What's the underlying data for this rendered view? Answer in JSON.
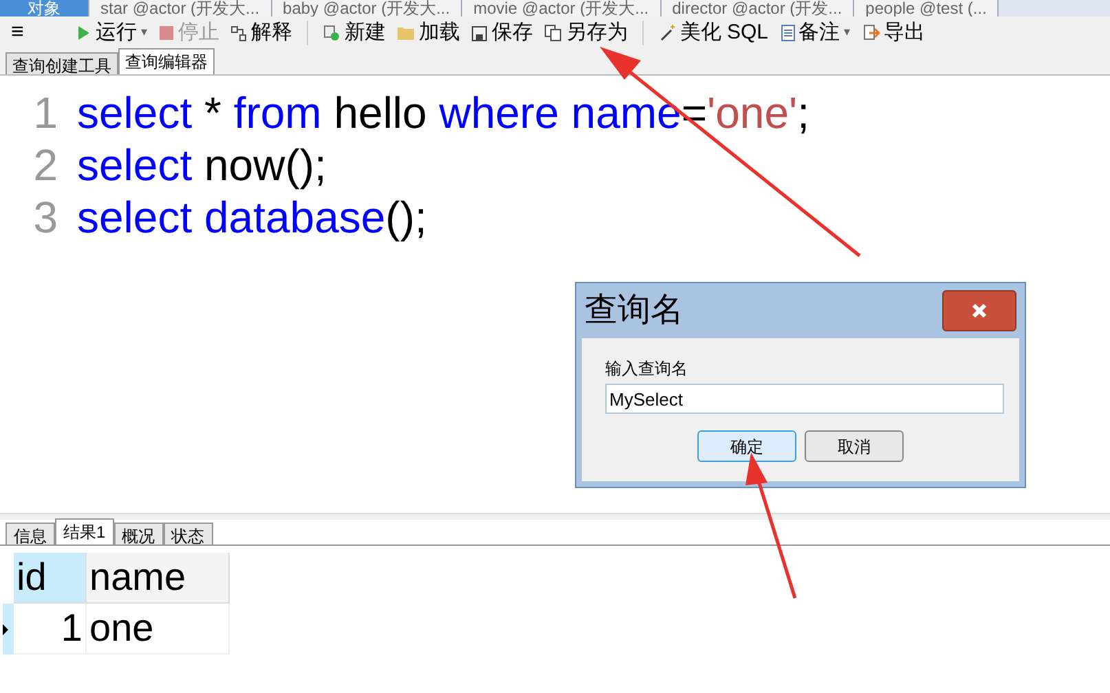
{
  "doc_tabs": [
    {
      "label": "对象",
      "selected": true
    },
    {
      "label": "star @actor (开发大...",
      "selected": false
    },
    {
      "label": "baby @actor (开发大...",
      "selected": false
    },
    {
      "label": "movie @actor (开发大...",
      "selected": false
    },
    {
      "label": "director @actor (开发...",
      "selected": false
    },
    {
      "label": "people @test (...",
      "selected": false
    }
  ],
  "toolbar": [
    {
      "label": "运行",
      "kind": "play",
      "caret": "▾"
    },
    {
      "label": "停止",
      "kind": "stop",
      "disabled": true
    },
    {
      "label": "解释",
      "kind": "explain",
      "disabled": false
    },
    {
      "label": "新建",
      "kind": "new",
      "disabled": false
    },
    {
      "label": "加载",
      "kind": "folder",
      "disabled": false
    },
    {
      "label": "保存",
      "kind": "save",
      "disabled": false
    },
    {
      "label": "另存为",
      "kind": "saveas",
      "disabled": false
    },
    {
      "label": "美化 SQL",
      "kind": "wand",
      "disabled": false
    },
    {
      "label": "备注",
      "kind": "note",
      "caret": "▾"
    },
    {
      "label": "导出",
      "kind": "export",
      "disabled": false
    }
  ],
  "menu_icon": "≡",
  "editor_tabs": [
    {
      "label": "查询创建工具",
      "selected": false
    },
    {
      "label": "查询编辑器",
      "selected": true
    }
  ],
  "code_lines": [
    {
      "number": "1",
      "tokens": [
        {
          "kind": "keyword",
          "text": "select"
        },
        {
          "kind": "plain",
          "text": " * "
        },
        {
          "kind": "keyword",
          "text": "from"
        },
        {
          "kind": "plain",
          "text": " hello "
        },
        {
          "kind": "keyword",
          "text": "where name"
        },
        {
          "kind": "plain",
          "text": "="
        },
        {
          "kind": "string",
          "text": "'one'"
        },
        {
          "kind": "plain",
          "text": ";"
        }
      ]
    },
    {
      "number": "2",
      "tokens": [
        {
          "kind": "keyword",
          "text": "select"
        },
        {
          "kind": "plain",
          "text": " now();"
        }
      ]
    },
    {
      "number": "3",
      "tokens": [
        {
          "kind": "keyword",
          "text": "select"
        },
        {
          "kind": "keyword",
          "text": " database"
        },
        {
          "kind": "plain",
          "text": "();"
        }
      ]
    }
  ],
  "dialog": {
    "title": "查询名",
    "label": "输入查询名",
    "value": "MySelect",
    "buttons": [
      {
        "label": "确定",
        "kind": "default"
      },
      {
        "label": "取消",
        "kind": "normal"
      }
    ]
  },
  "result_tabs": [
    {
      "label": "信息",
      "selected": false
    },
    {
      "label": "结果1",
      "selected": true
    },
    {
      "label": "概况",
      "selected": false
    },
    {
      "label": "状态",
      "selected": false
    }
  ],
  "table": {
    "columns": [
      {
        "label": "id",
        "selected": true
      },
      {
        "label": "name",
        "selected": false
      }
    ],
    "rows": [
      {
        "current": true,
        "cells": [
          "1",
          "one"
        ]
      }
    ]
  }
}
